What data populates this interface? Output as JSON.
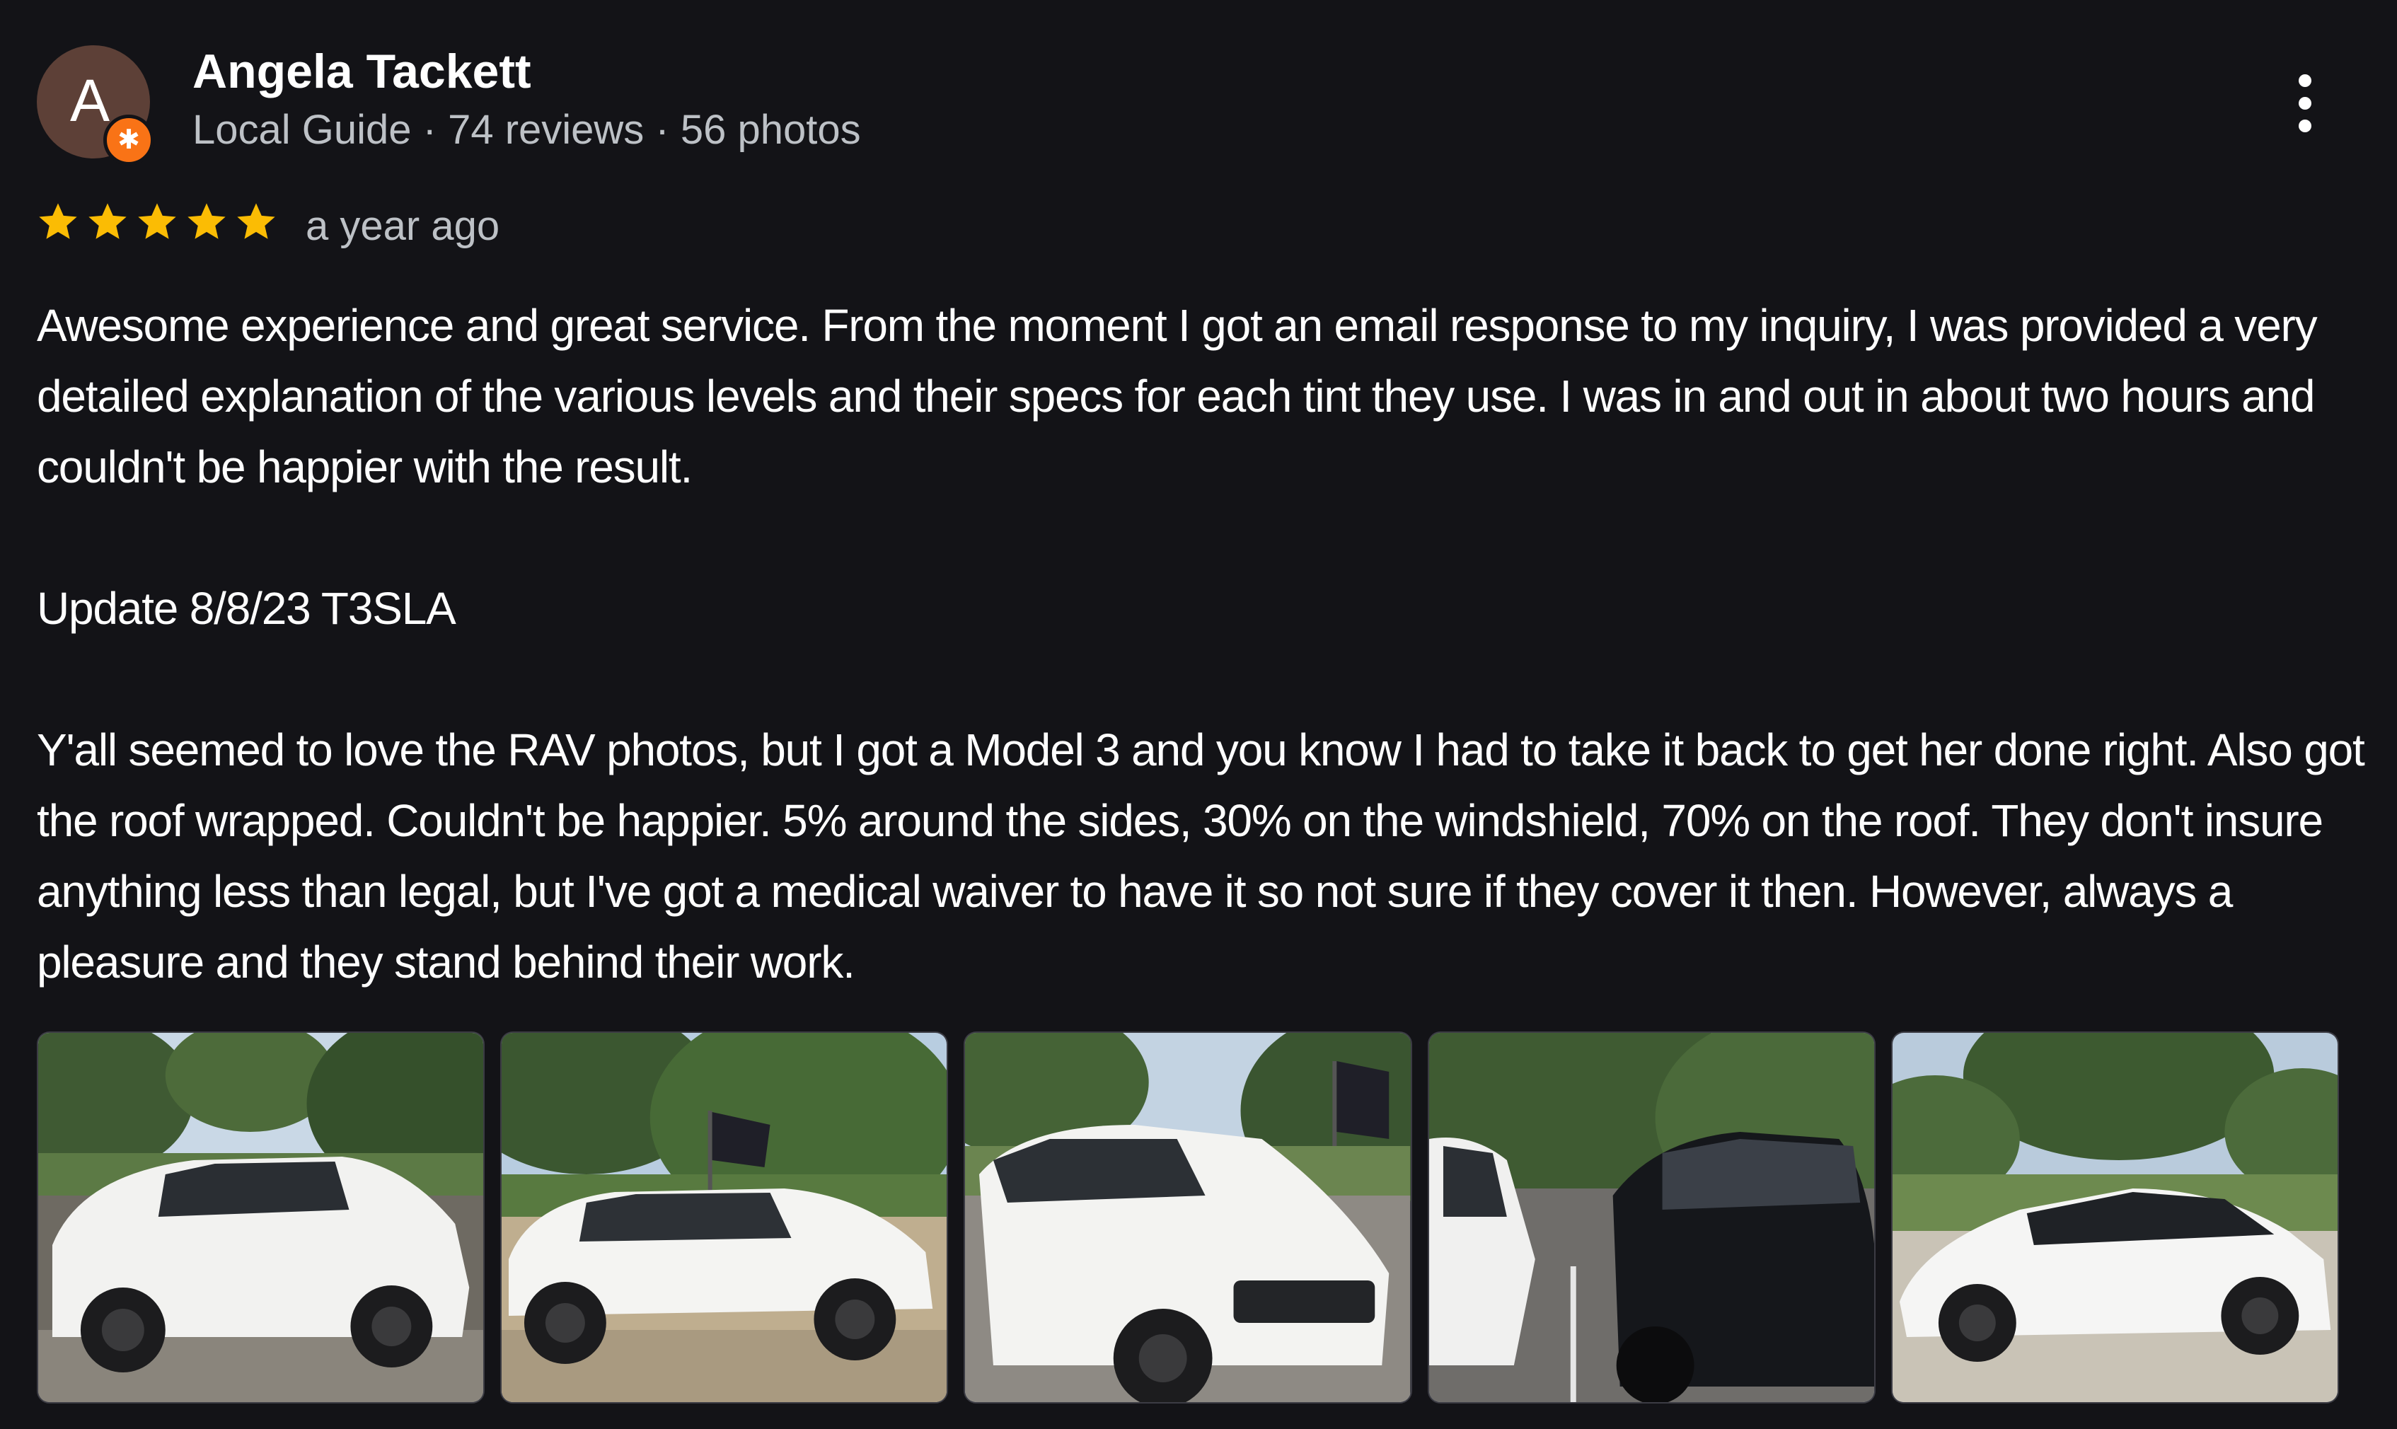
{
  "reviewer": {
    "avatar_letter": "A",
    "name": "Angela Tackett",
    "meta": "Local Guide · 74 reviews · 56 photos"
  },
  "rating": {
    "stars": 5,
    "max_stars": 5,
    "time": "a year ago"
  },
  "review": {
    "paragraphs": [
      "Awesome experience and great service. From the moment I got an email response to my inquiry, I was provided a very detailed explanation of the various levels and their specs for each tint they use. I was in and out in about two hours and couldn't be happier with the result.",
      "Update 8/8/23 T3SLA",
      "Y'all seemed to love the RAV photos, but I got a Model 3 and you know I had to take it back to get her done right. Also got the roof wrapped. Couldn't be happier. 5% around the sides, 30% on the windshield, 70% on the roof. They don't insure anything less than legal, but I've got a medical waiver to have it so not sure if they cover it then. However, always a pleasure and they stand behind their work."
    ]
  },
  "photos": [
    {
      "subject": "white-suv-side"
    },
    {
      "subject": "white-suv-side-flag"
    },
    {
      "subject": "white-suv-front"
    },
    {
      "subject": "two-sedans-parked"
    },
    {
      "subject": "white-sedan-side"
    }
  ],
  "colors": {
    "background": "#131317",
    "star": "#fbbc04",
    "badge": "#f97316",
    "avatar": "#5d4037"
  }
}
